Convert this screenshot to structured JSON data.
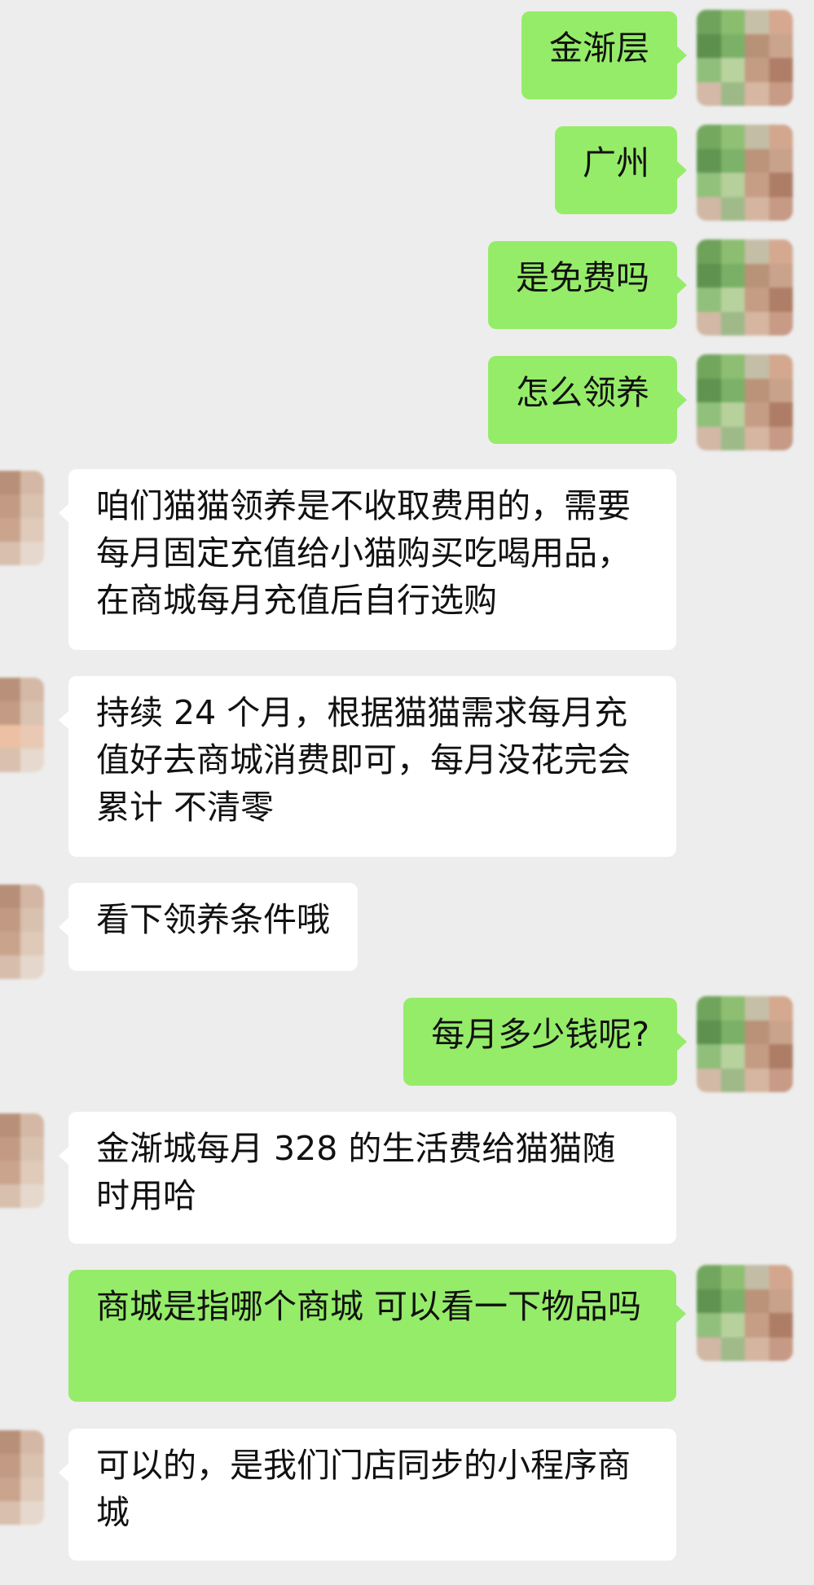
{
  "conversation": {
    "messages": [
      {
        "side": "out",
        "text": "金渐层"
      },
      {
        "side": "out",
        "text": "广州"
      },
      {
        "side": "out",
        "text": "是免费吗"
      },
      {
        "side": "out",
        "text": "怎么领养"
      },
      {
        "side": "in",
        "text": "咱们猫猫领养是不收取费用的，需要每月固定充值给小猫购买吃喝用品，在商城每月充值后自行选购"
      },
      {
        "side": "in",
        "text": "持续 24 个月，根据猫猫需求每月充值好去商城消费即可，每月没花完会累计 不清零"
      },
      {
        "side": "in",
        "text": "看下领养条件哦"
      },
      {
        "side": "out",
        "text": "每月多少钱呢?"
      },
      {
        "side": "in",
        "text": "金渐城每月 328 的生活费给猫猫随时用哈"
      },
      {
        "side": "out",
        "text": "商城是指哪个商城 可以看一下物品吗"
      },
      {
        "side": "in",
        "text": "可以的，是我们门店同步的小程序商城"
      }
    ]
  },
  "colors": {
    "background": "#ededed",
    "outgoing_bubble": "#95ec69",
    "incoming_bubble": "#ffffff",
    "text": "#111111"
  },
  "icons": {
    "self_avatar": "pixelated-avatar-icon",
    "contact_avatar": "pixelated-avatar-icon"
  }
}
